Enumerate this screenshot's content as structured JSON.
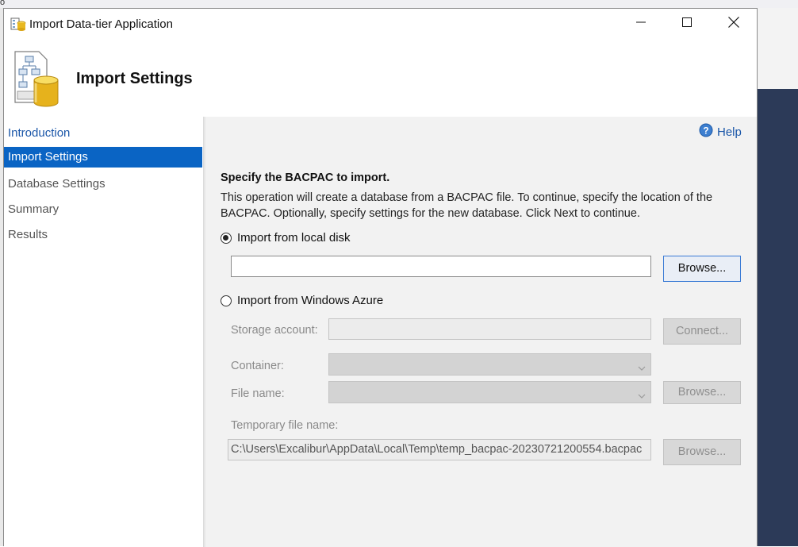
{
  "desktop": {
    "stub_text": "o"
  },
  "window": {
    "title": "Import Data-tier Application",
    "icons": {
      "app": "data-tier-app-icon",
      "minimize": "minimize-icon",
      "maximize": "maximize-icon",
      "close": "close-icon"
    }
  },
  "header": {
    "title": "Import Settings",
    "icon": "database-schema-icon"
  },
  "sidebar": {
    "items": [
      {
        "label": "Introduction",
        "state": "link"
      },
      {
        "label": "Import Settings",
        "state": "active"
      },
      {
        "label": "Database Settings",
        "state": "inactive"
      },
      {
        "label": "Summary",
        "state": "inactive"
      },
      {
        "label": "Results",
        "state": "inactive"
      }
    ]
  },
  "main": {
    "help_label": "Help",
    "section_heading": "Specify the BACPAC to import.",
    "description": "This operation will create a database from a BACPAC file. To continue, specify the location of the BACPAC.  Optionally, specify settings for the new database. Click Next to continue.",
    "local_disk": {
      "radio_label": "Import from local disk",
      "selected": true,
      "path_value": "",
      "browse_label": "Browse..."
    },
    "azure": {
      "radio_label": "Import from Windows Azure",
      "selected": false,
      "storage_account_label": "Storage account:",
      "storage_account_value": "",
      "connect_label": "Connect...",
      "container_label": "Container:",
      "container_value": "",
      "file_name_label": "File name:",
      "file_name_value": "",
      "browse_label": "Browse...",
      "temp_file_label": "Temporary file name:",
      "temp_file_value": "C:\\Users\\Excalibur\\AppData\\Local\\Temp\\temp_bacpac-20230721200554.bacpac",
      "temp_browse_label": "Browse..."
    }
  },
  "colors": {
    "accent": "#0a64c4",
    "link": "#1a56a8",
    "panel_bg": "#f2f2f2",
    "disabled_text": "#8f8f8f"
  }
}
